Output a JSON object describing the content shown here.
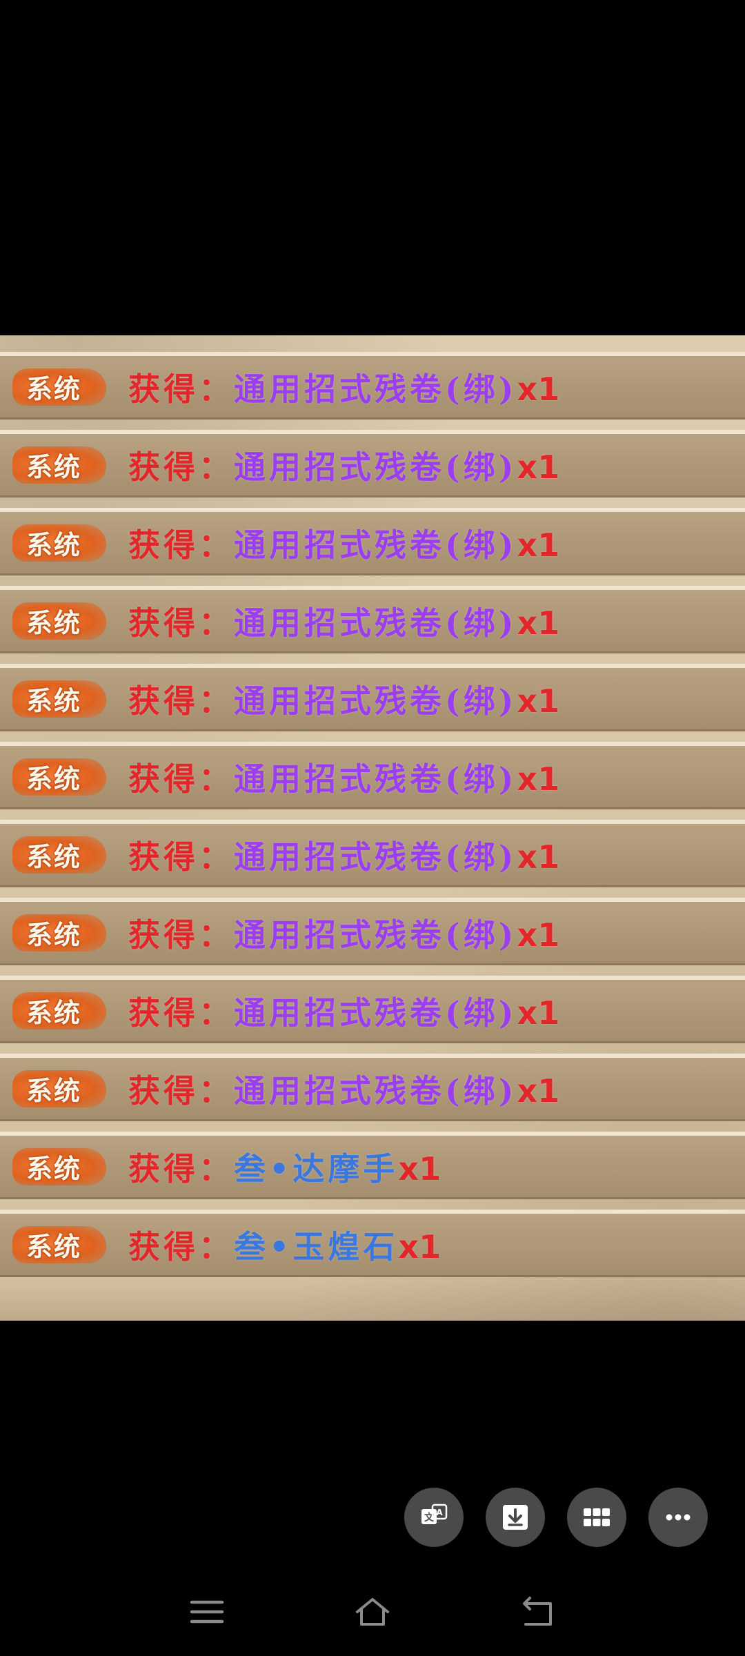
{
  "log": {
    "rows": [
      {
        "badge": "系统",
        "prefix": "获得：",
        "item": "通用招式残卷(绑)",
        "qty": "x1",
        "item_color": "purple"
      },
      {
        "badge": "系统",
        "prefix": "获得：",
        "item": "通用招式残卷(绑)",
        "qty": "x1",
        "item_color": "purple"
      },
      {
        "badge": "系统",
        "prefix": "获得：",
        "item": "通用招式残卷(绑)",
        "qty": "x1",
        "item_color": "purple"
      },
      {
        "badge": "系统",
        "prefix": "获得：",
        "item": "通用招式残卷(绑)",
        "qty": "x1",
        "item_color": "purple"
      },
      {
        "badge": "系统",
        "prefix": "获得：",
        "item": "通用招式残卷(绑)",
        "qty": "x1",
        "item_color": "purple"
      },
      {
        "badge": "系统",
        "prefix": "获得：",
        "item": "通用招式残卷(绑)",
        "qty": "x1",
        "item_color": "purple"
      },
      {
        "badge": "系统",
        "prefix": "获得：",
        "item": "通用招式残卷(绑)",
        "qty": "x1",
        "item_color": "purple"
      },
      {
        "badge": "系统",
        "prefix": "获得：",
        "item": "通用招式残卷(绑)",
        "qty": "x1",
        "item_color": "purple"
      },
      {
        "badge": "系统",
        "prefix": "获得：",
        "item": "通用招式残卷(绑)",
        "qty": "x1",
        "item_color": "purple"
      },
      {
        "badge": "系统",
        "prefix": "获得：",
        "item": "通用招式残卷(绑)",
        "qty": "x1",
        "item_color": "purple"
      },
      {
        "badge": "系统",
        "prefix": "获得：",
        "item": "叁•达摩手",
        "qty": "x1",
        "item_color": "blue"
      },
      {
        "badge": "系统",
        "prefix": "获得：",
        "item": "叁•玉煌石",
        "qty": "x1",
        "item_color": "blue"
      }
    ]
  },
  "actions": [
    {
      "name": "translate-button",
      "icon": "translate-icon"
    },
    {
      "name": "download-button",
      "icon": "download-icon"
    },
    {
      "name": "apps-button",
      "icon": "grid-icon"
    },
    {
      "name": "more-button",
      "icon": "more-icon"
    }
  ],
  "colors": {
    "prefix": "#e3262a",
    "item_purple": "#9a3ef0",
    "item_blue": "#3a78e0",
    "badge": "#e0621f",
    "fab": "#4a4a4a"
  }
}
